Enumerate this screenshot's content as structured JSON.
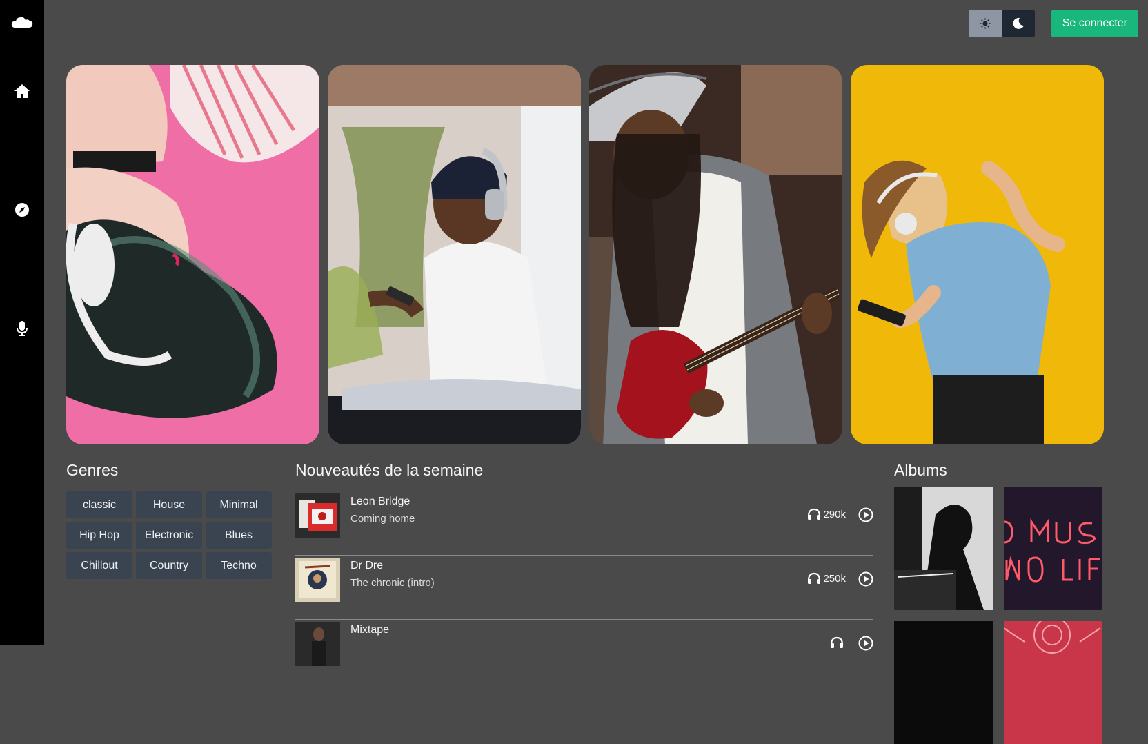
{
  "header": {
    "login_label": "Se connecter"
  },
  "sidebar": {
    "items": [
      {
        "icon": "cloud-logo-icon"
      },
      {
        "icon": "home-icon"
      },
      {
        "icon": "compass-icon"
      },
      {
        "icon": "microphone-icon"
      }
    ]
  },
  "genres": {
    "title": "Genres",
    "items": [
      "classic",
      "House",
      "Minimal",
      "Hip Hop",
      "Electronic",
      "Blues",
      "Chillout",
      "Country",
      "Techno"
    ]
  },
  "new_releases": {
    "title": "Nouveautés de la semaine",
    "tracks": [
      {
        "artist": "Leon Bridge",
        "title": "Coming home",
        "plays": "290k"
      },
      {
        "artist": "Dr Dre",
        "title": "The chronic (intro)",
        "plays": "250k"
      },
      {
        "artist": "Mixtape",
        "title": "",
        "plays": ""
      }
    ]
  },
  "albums": {
    "title": "Albums"
  },
  "colors": {
    "background": "#4a4a4a",
    "sidebar": "#000000",
    "accent": "#19b77c",
    "chip": "#3a4350"
  }
}
